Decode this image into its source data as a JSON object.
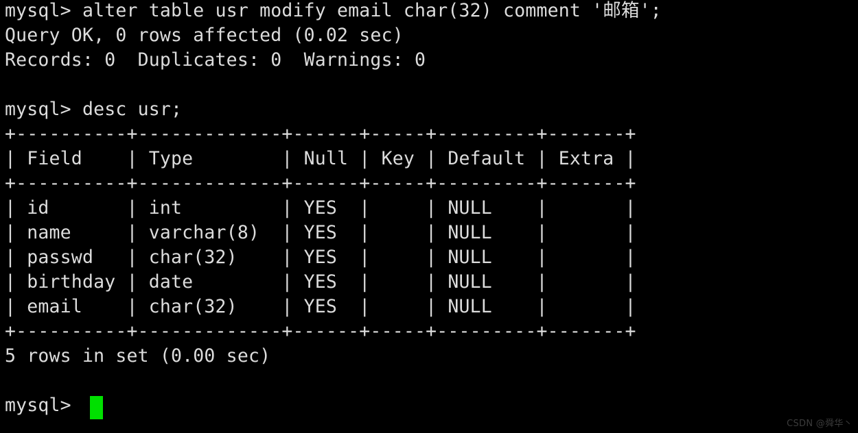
{
  "terminal": {
    "background_color": "#000000",
    "text_color": "#dcdcdc",
    "cursor_color": "#00e000",
    "prompt": "mysql> ",
    "lines": [
      {
        "id": "command-alter-table",
        "text": "mysql> alter table usr modify email char(32) comment '邮箱';"
      },
      {
        "id": "result-query-ok",
        "text": "Query OK, 0 rows affected (0.02 sec)"
      },
      {
        "id": "result-records",
        "text": "Records: 0  Duplicates: 0  Warnings: 0"
      },
      {
        "id": "blank-1",
        "text": " "
      },
      {
        "id": "command-desc-usr",
        "text": "mysql> desc usr;"
      },
      {
        "id": "table-border-top",
        "text": "+----------+-------------+------+-----+---------+-------+"
      },
      {
        "id": "table-header-row",
        "text": "| Field    | Type        | Null | Key | Default | Extra |"
      },
      {
        "id": "table-border-mid",
        "text": "+----------+-------------+------+-----+---------+-------+"
      },
      {
        "id": "table-row-id",
        "text": "| id       | int         | YES  |     | NULL    |       |"
      },
      {
        "id": "table-row-name",
        "text": "| name     | varchar(8)  | YES  |     | NULL    |       |"
      },
      {
        "id": "table-row-passwd",
        "text": "| passwd   | char(32)    | YES  |     | NULL    |       |"
      },
      {
        "id": "table-row-birthday",
        "text": "| birthday | date        | YES  |     | NULL    |       |"
      },
      {
        "id": "table-row-email",
        "text": "| email    | char(32)    | YES  |     | NULL    |       |"
      },
      {
        "id": "table-border-bottom",
        "text": "+----------+-------------+------+-----+---------+-------+"
      },
      {
        "id": "result-row-count",
        "text": "5 rows in set (0.00 sec)"
      },
      {
        "id": "blank-2",
        "text": " "
      },
      {
        "id": "prompt-active",
        "text": "mysql> "
      }
    ],
    "command_alter": {
      "prompt": "mysql> ",
      "statement": "alter table usr modify email char(32) comment '",
      "comment_cjk": "邮箱",
      "statement_end": "';"
    },
    "desc_table": {
      "columns": [
        "Field",
        "Type",
        "Null",
        "Key",
        "Default",
        "Extra"
      ],
      "rows": [
        {
          "Field": "id",
          "Type": "int",
          "Null": "YES",
          "Key": "",
          "Default": "NULL",
          "Extra": ""
        },
        {
          "Field": "name",
          "Type": "varchar(8)",
          "Null": "YES",
          "Key": "",
          "Default": "NULL",
          "Extra": ""
        },
        {
          "Field": "passwd",
          "Type": "char(32)",
          "Null": "YES",
          "Key": "",
          "Default": "NULL",
          "Extra": ""
        },
        {
          "Field": "birthday",
          "Type": "date",
          "Null": "YES",
          "Key": "",
          "Default": "NULL",
          "Extra": ""
        },
        {
          "Field": "email",
          "Type": "char(32)",
          "Null": "YES",
          "Key": "",
          "Default": "NULL",
          "Extra": ""
        }
      ],
      "row_count_text": "5 rows in set (0.00 sec)"
    }
  },
  "watermark": {
    "text": "CSDN @舜华丶"
  }
}
